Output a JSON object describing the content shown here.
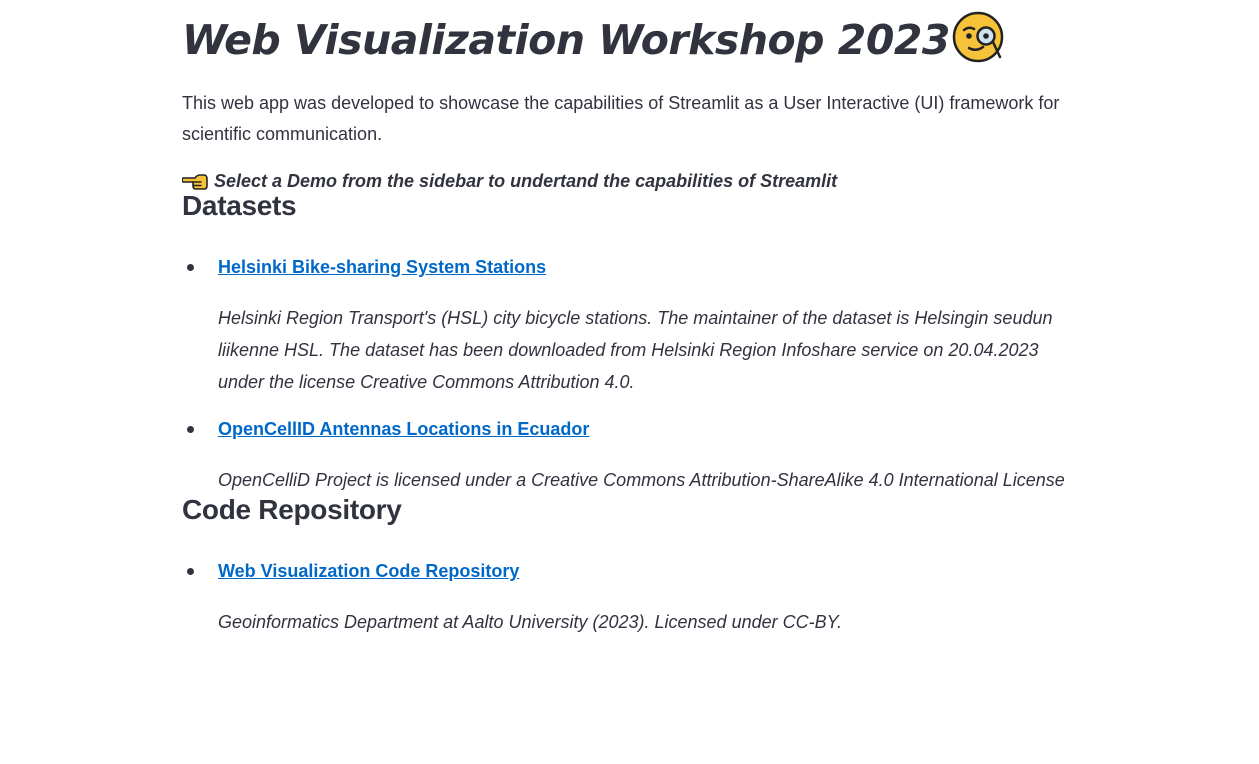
{
  "page": {
    "title": "Web Visualization Workshop 2023",
    "title_emoji": "face-with-monocle-icon",
    "intro": "This web app was developed to showcase the capabilities of Streamlit as a User Interactive (UI) framework for scientific communication.",
    "callout_icon": "backhand-pointing-left-icon",
    "callout": "Select a Demo from the sidebar to undertand the capabilities of Streamlit"
  },
  "datasets": {
    "heading": "Datasets",
    "items": [
      {
        "link": "Helsinki Bike-sharing System Stations",
        "description": "Helsinki Region Transport's (HSL) city bicycle stations. The maintainer of the dataset is Helsingin seudun liikenne HSL. The dataset has been downloaded from Helsinki Region Infoshare service on 20.04.2023 under the license Creative Commons Attribution 4.0."
      },
      {
        "link": "OpenCellID Antennas Locations in Ecuador",
        "description": "OpenCelliD Project is licensed under a Creative Commons Attribution-ShareAlike 4.0 International License"
      }
    ]
  },
  "code": {
    "heading": "Code Repository",
    "items": [
      {
        "link": "Web Visualization Code Repository",
        "description": "Geoinformatics Department at Aalto University (2023). Licensed under CC-BY."
      }
    ]
  },
  "colors": {
    "text": "#31333f",
    "link": "#0068c9",
    "background": "#ffffff"
  }
}
